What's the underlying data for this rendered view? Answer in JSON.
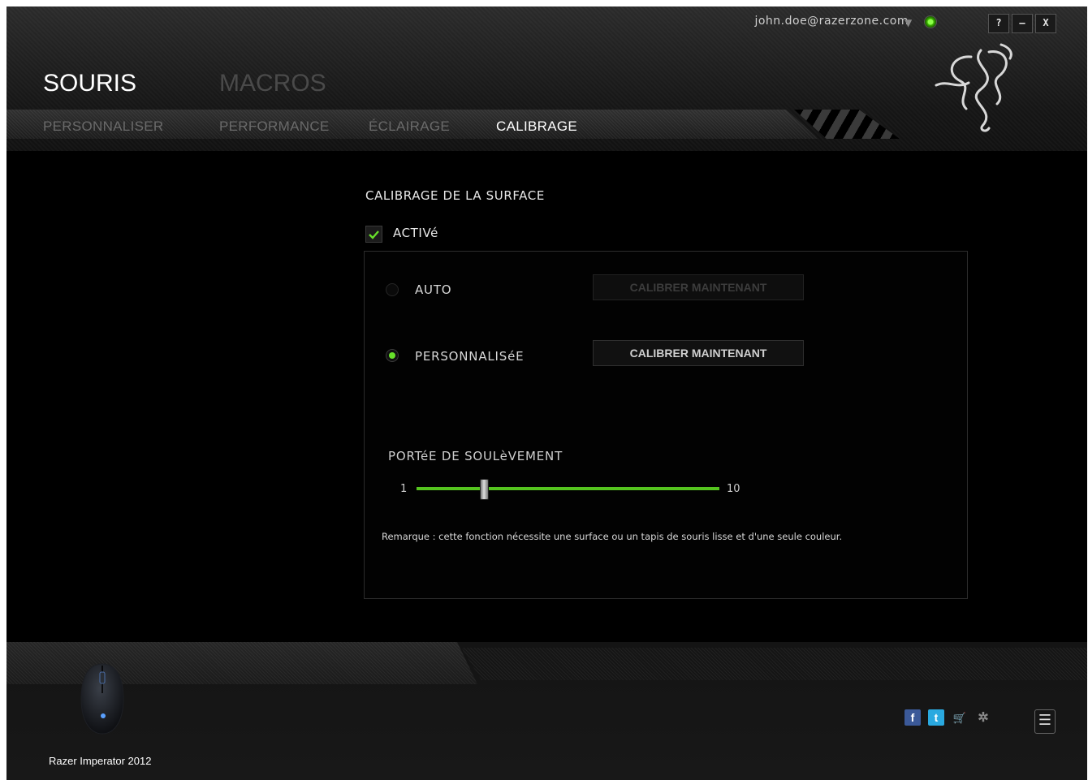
{
  "account": {
    "email": "john.doe@razerzone.com",
    "dropdown_glyph": "▼"
  },
  "window_controls": {
    "help": "?",
    "minimize": "–",
    "close": "X"
  },
  "main_tabs": [
    {
      "label": "SOURIS",
      "active": true
    },
    {
      "label": "MACROS",
      "active": false
    }
  ],
  "sub_tabs": [
    {
      "label": "PERSONNALISER",
      "active": false
    },
    {
      "label": "PERFORMANCE",
      "active": false
    },
    {
      "label": "ÉCLAIRAGE",
      "active": false
    },
    {
      "label": "CALIBRAGE",
      "active": true
    }
  ],
  "calibration": {
    "title": "CALIBRAGE DE LA SURFACE",
    "enabled_label": "ACTIVé",
    "enabled": true,
    "options": [
      {
        "label": "AUTO",
        "selected": false,
        "button": "CALIBRER MAINTENANT",
        "button_enabled": false
      },
      {
        "label": "PERSONNALISéE",
        "selected": true,
        "button": "CALIBRER MAINTENANT",
        "button_enabled": true
      }
    ],
    "lift": {
      "title": "PORTéE DE SOULèVEMENT",
      "min_label": "1",
      "max_label": "10",
      "min": 1,
      "max": 10,
      "value": 3
    },
    "note": "Remarque : cette fonction nécessite une surface ou un tapis de souris lisse et d'une seule couleur."
  },
  "device": {
    "name": "Razer Imperator 2012"
  },
  "social": [
    {
      "icon": "facebook-icon",
      "glyph": "f",
      "color": "#3b5998"
    },
    {
      "icon": "twitter-icon",
      "glyph": "t",
      "color": "#2aa9e0"
    },
    {
      "icon": "store-cart-icon",
      "glyph": "🛒",
      "color": "#777777"
    },
    {
      "icon": "razer-icon",
      "glyph": "✲",
      "color": "#777777"
    }
  ],
  "colors": {
    "accent": "#67e02a",
    "background": "#000000",
    "inactive_text": "#6a6a6a"
  }
}
